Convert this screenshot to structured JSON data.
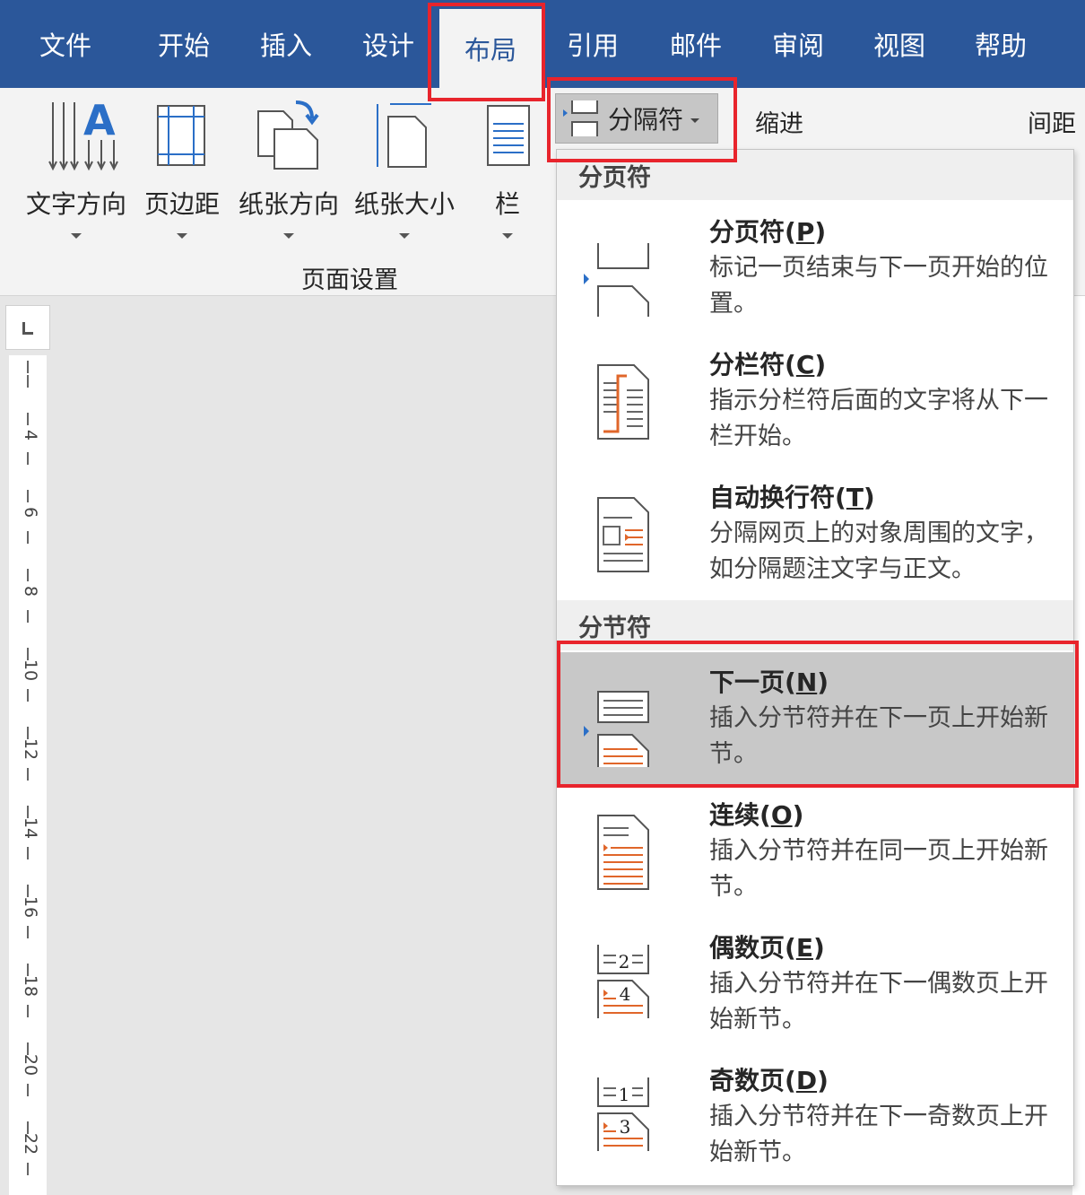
{
  "tabs": [
    {
      "label": "文件"
    },
    {
      "label": "开始"
    },
    {
      "label": "插入"
    },
    {
      "label": "设计"
    },
    {
      "label": "布局"
    },
    {
      "label": "引用"
    },
    {
      "label": "邮件"
    },
    {
      "label": "审阅"
    },
    {
      "label": "视图"
    },
    {
      "label": "帮助"
    }
  ],
  "active_tab": "布局",
  "ribbon": {
    "text_direction": "文字方向",
    "margins": "页边距",
    "orientation": "纸张方向",
    "size": "纸张大小",
    "columns": "栏",
    "group_label": "页面设置",
    "breaks": "分隔符",
    "indent": "缩进",
    "spacing": "间距"
  },
  "dropdown": {
    "page_breaks_header": "分页符",
    "section_breaks_header": "分节符",
    "items": [
      {
        "title": "分页符(",
        "key": "P",
        "title_end": ")",
        "desc": "标记一页结束与下一页开始的位置。",
        "icon": "page-break-icon"
      },
      {
        "title": "分栏符(",
        "key": "C",
        "title_end": ")",
        "desc": "指示分栏符后面的文字将从下一栏开始。",
        "icon": "column-break-icon"
      },
      {
        "title": "自动换行符(",
        "key": "T",
        "title_end": ")",
        "desc": "分隔网页上的对象周围的文字，如分隔题注文字与正文。",
        "icon": "text-wrapping-icon"
      },
      {
        "title": "下一页(",
        "key": "N",
        "title_end": ")",
        "desc": "插入分节符并在下一页上开始新节。",
        "icon": "next-page-icon",
        "selected": true
      },
      {
        "title": "连续(",
        "key": "O",
        "title_end": ")",
        "desc": "插入分节符并在同一页上开始新节。",
        "icon": "continuous-icon"
      },
      {
        "title": "偶数页(",
        "key": "E",
        "title_end": ")",
        "desc": "插入分节符并在下一偶数页上开始新节。",
        "icon": "even-page-icon",
        "page_a": "2",
        "page_b": "4"
      },
      {
        "title": "奇数页(",
        "key": "D",
        "title_end": ")",
        "desc": "插入分节符并在下一奇数页上开始新节。",
        "icon": "odd-page-icon",
        "page_a": "1",
        "page_b": "3"
      }
    ]
  },
  "ruler": {
    "numbers": [
      "4",
      "6",
      "8",
      "10",
      "12",
      "14",
      "16",
      "18",
      "20",
      "22"
    ]
  },
  "colors": {
    "tab_bar": "#2b579a",
    "highlight": "#e8242c",
    "icon_orange": "#e0662a",
    "selected_item": "#c8c8c8"
  }
}
